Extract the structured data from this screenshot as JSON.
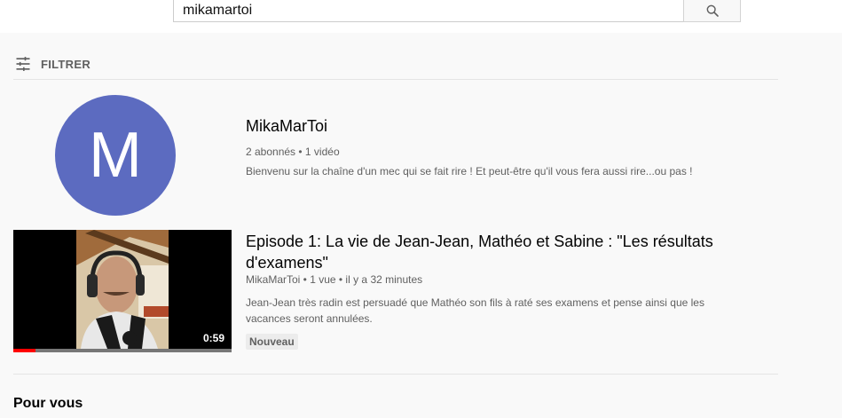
{
  "search": {
    "query": "mikamartoi",
    "button_icon": "search-icon"
  },
  "filter": {
    "label": "FILTRER",
    "icon": "tune-icon"
  },
  "channel": {
    "avatar_letter": "M",
    "avatar_color": "#5c6bc0",
    "name": "MikaMarToi",
    "meta": "2 abonnés • 1 vidéo",
    "description": "Bienvenu sur la chaîne d'un mec qui se fait rire ! Et peut-être qu'il vous fera aussi rire...ou pas !"
  },
  "video": {
    "title": "Episode 1: La vie de Jean-Jean, Mathéo et Sabine : \"Les résultats d'examens\"",
    "meta": "MikaMarToi • 1 vue • il y a 32 minutes",
    "description": "Jean-Jean très radin est persuadé que Mathéo son fils à raté ses examens et pense ainsi que les vacances seront annulées.",
    "duration": "0:59",
    "badge": "Nouveau",
    "watched_fraction": 0.1,
    "progress_color": "#ff0000"
  },
  "section": {
    "title": "Pour vous"
  }
}
